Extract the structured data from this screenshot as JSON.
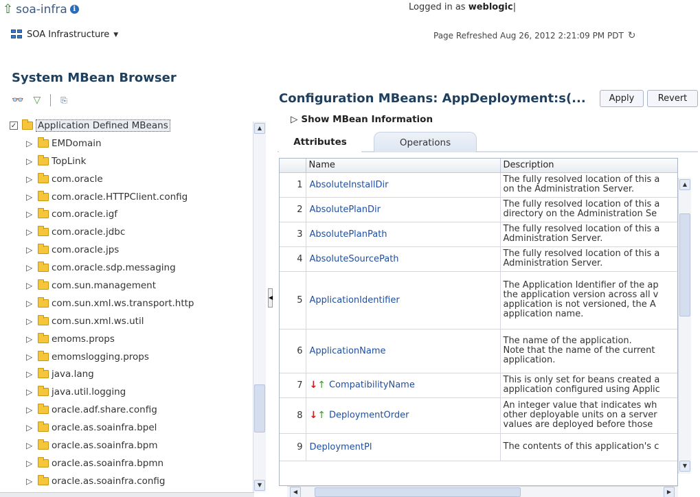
{
  "header": {
    "title": "soa-infra",
    "menu_label": "SOA Infrastructure",
    "logged_in_prefix": "Logged in as",
    "username": "weblogic",
    "refresh_text": "Page Refreshed Aug 26, 2012 2:21:09 PM PDT"
  },
  "left_panel": {
    "title": "System MBean Browser",
    "root_label": "Application Defined MBeans",
    "items": [
      "EMDomain",
      "TopLink",
      "com.oracle",
      "com.oracle.HTTPClient.config",
      "com.oracle.igf",
      "com.oracle.jdbc",
      "com.oracle.jps",
      "com.oracle.sdp.messaging",
      "com.sun.management",
      "com.sun.xml.ws.transport.http",
      "com.sun.xml.ws.util",
      "emoms.props",
      "emomslogging.props",
      "java.lang",
      "java.util.logging",
      "oracle.adf.share.config",
      "oracle.as.soainfra.bpel",
      "oracle.as.soainfra.bpm",
      "oracle.as.soainfra.bpmn",
      "oracle.as.soainfra.config"
    ]
  },
  "right_panel": {
    "title": "Configuration MBeans: AppDeployment:s(...",
    "apply_label": "Apply",
    "revert_label": "Revert",
    "show_info_label": "Show MBean Information",
    "tabs": [
      "Attributes",
      "Operations"
    ],
    "columns": [
      "Name",
      "Description"
    ],
    "rows": [
      {
        "num": "1",
        "name": "AbsoluteInstallDir",
        "icon": false,
        "desc": [
          "The fully resolved location of this a",
          "on the Administration Server."
        ]
      },
      {
        "num": "2",
        "name": "AbsolutePlanDir",
        "icon": false,
        "desc": [
          "The fully resolved location of this a",
          "directory on the Administration Se"
        ]
      },
      {
        "num": "3",
        "name": "AbsolutePlanPath",
        "icon": false,
        "desc": [
          "The fully resolved location of this a",
          "Administration Server."
        ]
      },
      {
        "num": "4",
        "name": "AbsoluteSourcePath",
        "icon": false,
        "desc": [
          "The fully resolved location of this a",
          "Administration Server."
        ]
      },
      {
        "num": "5",
        "name": "ApplicationIdentifier",
        "icon": false,
        "desc": [
          "The Application Identifier of the ap",
          "the application version across all v",
          "application is not versioned, the A",
          "application name."
        ]
      },
      {
        "num": "6",
        "name": "ApplicationName",
        "icon": false,
        "desc": [
          "The name of the application.",
          "Note that the name of the current",
          "application."
        ]
      },
      {
        "num": "7",
        "name": "CompatibilityName",
        "icon": true,
        "desc": [
          "This is only set for beans created a",
          "application configured using Applic"
        ]
      },
      {
        "num": "8",
        "name": "DeploymentOrder",
        "icon": true,
        "desc": [
          "An integer value that indicates wh",
          "other deployable units on a server",
          "values are deployed before those"
        ]
      },
      {
        "num": "9",
        "name": "DeploymentPl",
        "icon": false,
        "desc": [
          "The contents of this application's c"
        ]
      }
    ]
  },
  "icons": {
    "up": "up-arrow-icon",
    "info": "info-icon",
    "soa": "soa-infrastructure-icon",
    "refresh": "refresh-icon",
    "binoculars": "binoculars-icon",
    "filter": "filter-icon",
    "export": "export-icon",
    "folder": "folder-icon",
    "edit": "editable-attribute-icon"
  },
  "colors": {
    "link": "#1f4fa0",
    "title": "#1f3f5f",
    "folder": "#f5c53a"
  }
}
